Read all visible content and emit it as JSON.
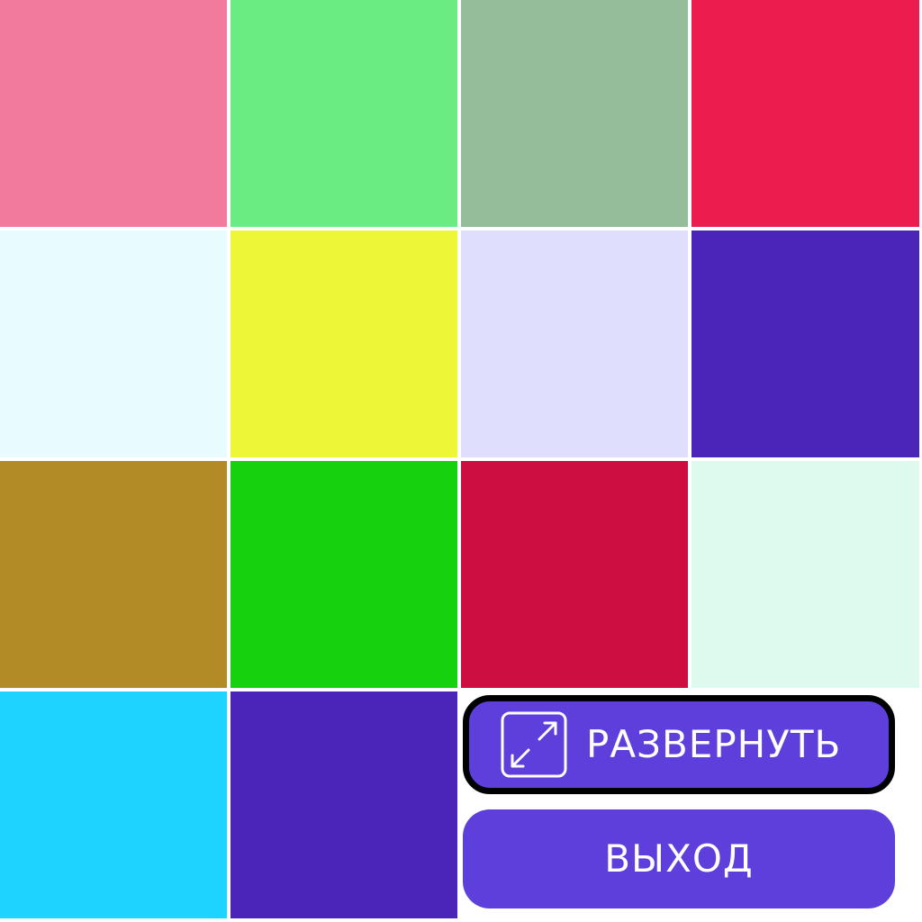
{
  "tiles": [
    {
      "color": "#f27a9d"
    },
    {
      "color": "#6aec82"
    },
    {
      "color": "#96bd9a"
    },
    {
      "color": "#ed1c4e"
    },
    {
      "color": "#e8fbfd"
    },
    {
      "color": "#eef735"
    },
    {
      "color": "#dfdefd"
    },
    {
      "color": "#4a25b8"
    },
    {
      "color": "#b28b27"
    },
    {
      "color": "#15d10e"
    },
    {
      "color": "#cc0f40"
    },
    {
      "color": "#def9ee"
    },
    {
      "color": "#1dd3ff"
    },
    {
      "color": "#4a25b8"
    }
  ],
  "buttons": {
    "expand_label": "РАЗВЕРНУТЬ",
    "exit_label": "ВЫХОД",
    "expand_icon": "expand-icon",
    "color": "#5e3fdc",
    "text_color": "#ffffff"
  }
}
